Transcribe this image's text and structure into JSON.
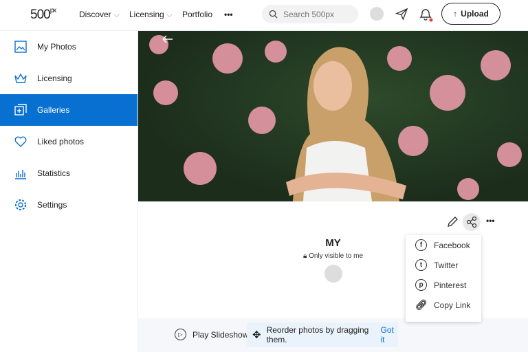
{
  "header": {
    "logo": "500",
    "logo_sup": "px",
    "nav": [
      "Discover",
      "Licensing",
      "Portfolio"
    ],
    "more": "•••",
    "search_placeholder": "Search 500px",
    "upload": "Upload"
  },
  "sidebar": {
    "items": [
      {
        "label": "My Photos",
        "icon": "photo-icon"
      },
      {
        "label": "Licensing",
        "icon": "crown-icon"
      },
      {
        "label": "Galleries",
        "icon": "galleries-icon",
        "active": true
      },
      {
        "label": "Liked photos",
        "icon": "heart-icon"
      },
      {
        "label": "Statistics",
        "icon": "chart-icon"
      },
      {
        "label": "Settings",
        "icon": "gear-icon"
      }
    ]
  },
  "gallery": {
    "title": "MY",
    "visibility": "Only visible to me"
  },
  "share_menu": {
    "items": [
      {
        "label": "Facebook",
        "icon": "f"
      },
      {
        "label": "Twitter",
        "icon": "t"
      },
      {
        "label": "Pinterest",
        "icon": "p"
      },
      {
        "label": "Copy Link",
        "icon": "link"
      }
    ]
  },
  "bottom": {
    "slideshow": "Play Slideshow",
    "reorder": "Reorder photos by dragging them.",
    "got_it": "Got it"
  },
  "colors": {
    "accent": "#0870d1"
  }
}
